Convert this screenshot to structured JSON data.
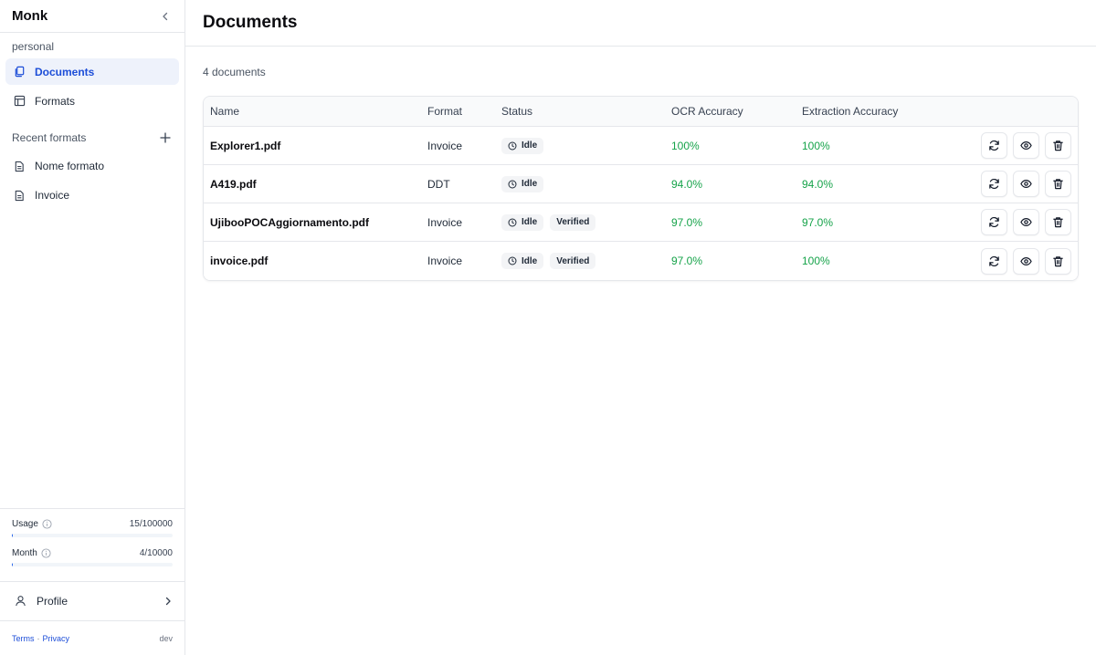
{
  "sidebar": {
    "app_title": "Monk",
    "workspace": "personal",
    "nav": [
      {
        "label": "Documents",
        "icon": "documents-icon",
        "active": true
      },
      {
        "label": "Formats",
        "icon": "table-icon",
        "active": false
      }
    ],
    "recent_label": "Recent formats",
    "recent": [
      {
        "label": "Nome formato",
        "icon": "file-icon"
      },
      {
        "label": "Invoice",
        "icon": "file-icon"
      }
    ],
    "usage": {
      "usage_label": "Usage",
      "usage_value": "15/100000",
      "usage_fraction": 0.00015,
      "month_label": "Month",
      "month_value": "4/10000",
      "month_fraction": 0.0004
    },
    "profile_label": "Profile",
    "footer": {
      "terms": "Terms",
      "separator": "·",
      "privacy": "Privacy",
      "env": "dev"
    }
  },
  "main": {
    "title": "Documents",
    "count_text": "4 documents",
    "columns": [
      "Name",
      "Format",
      "Status",
      "OCR Accuracy",
      "Extraction Accuracy"
    ],
    "rows": [
      {
        "name": "Explorer1.pdf",
        "format": "Invoice",
        "status": "Idle",
        "verified": "",
        "ocr": "100%",
        "extraction": "100%"
      },
      {
        "name": "A419.pdf",
        "format": "DDT",
        "status": "Idle",
        "verified": "",
        "ocr": "94.0%",
        "extraction": "94.0%"
      },
      {
        "name": "UjibooPOCAggiornamento.pdf",
        "format": "Invoice",
        "status": "Idle",
        "verified": "Verified",
        "ocr": "97.0%",
        "extraction": "97.0%"
      },
      {
        "name": "invoice.pdf",
        "format": "Invoice",
        "status": "Idle",
        "verified": "Verified",
        "ocr": "97.0%",
        "extraction": "100%"
      }
    ]
  },
  "colors": {
    "accent": "#1d4ed8",
    "success": "#16a34a",
    "active_bg": "#eef2fb"
  }
}
